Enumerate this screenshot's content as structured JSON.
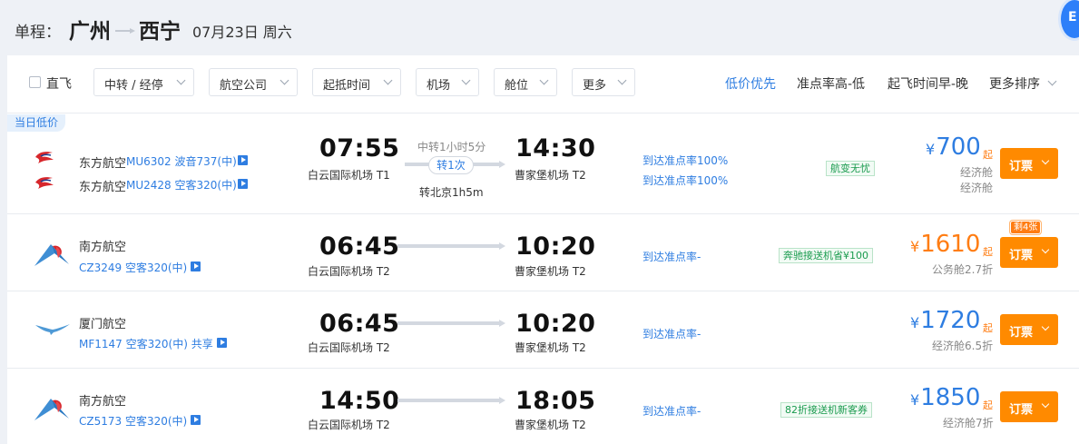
{
  "header": {
    "trip_label": "单程：",
    "from_city": "广州",
    "to_city": "西宁",
    "date": "07月23日 周六"
  },
  "filters": {
    "direct_label": "直飞",
    "dropdowns": [
      "中转 / 经停",
      "航空公司",
      "起抵时间",
      "机场",
      "舱位",
      "更多"
    ]
  },
  "sorts": [
    "低价优先",
    "准点率高-低",
    "起飞时间早-晚",
    "更多排序"
  ],
  "colors": {
    "accent": "#2e7de1",
    "book_button": "#ff8a00",
    "price_orange": "#ff7d13",
    "service_green": "#1a9b4e"
  },
  "flights": [
    {
      "tag": "当日低价",
      "legs": [
        {
          "airline": "东方航空",
          "flight_no": "MU6302",
          "aircraft": "波音737(中)",
          "logo": "china-eastern-logo-icon"
        },
        {
          "airline": "东方航空",
          "flight_no": "MU2428",
          "aircraft": "空客320(中)",
          "logo": "china-eastern-logo-icon"
        }
      ],
      "dep_time": "07:55",
      "dep_airport": "白云国际机场",
      "dep_terminal": "T1",
      "transfer_duration": "中转1小时5分",
      "transfer_count": "转1次",
      "transfer_detail": "转北京1h5m",
      "arr_time": "14:30",
      "arr_airport": "曹家堡机场",
      "arr_terminal": "T2",
      "ontime": [
        "到达准点率100%",
        "到达准点率100%"
      ],
      "service": "航变无忧",
      "price": "700",
      "currency": "¥",
      "price_suffix": "起",
      "cabin": [
        "经济舱",
        "经济舱"
      ],
      "book_label": "订票"
    },
    {
      "airline": "南方航空",
      "flight_no": "CZ3249",
      "aircraft": "空客320(中)",
      "logo": "china-southern-logo-icon",
      "dep_time": "06:45",
      "dep_airport": "白云国际机场",
      "dep_terminal": "T2",
      "arr_time": "10:20",
      "arr_airport": "曹家堡机场",
      "arr_terminal": "T2",
      "ontime": "到达准点率-",
      "service": "奔驰接送机省¥100",
      "price": "1610",
      "currency": "¥",
      "price_suffix": "起",
      "cabin": "公务舱2.7折",
      "seats_left": "剩4张",
      "book_label": "订票"
    },
    {
      "airline": "厦门航空",
      "flight_no": "MF1147",
      "aircraft": "空客320(中)",
      "shared": "共享",
      "logo": "xiamen-airlines-logo-icon",
      "dep_time": "06:45",
      "dep_airport": "白云国际机场",
      "dep_terminal": "T2",
      "arr_time": "10:20",
      "arr_airport": "曹家堡机场",
      "arr_terminal": "T2",
      "ontime": "到达准点率-",
      "price": "1720",
      "currency": "¥",
      "price_suffix": "起",
      "cabin": "经济舱6.5折",
      "book_label": "订票"
    },
    {
      "airline": "南方航空",
      "flight_no": "CZ5173",
      "aircraft": "空客320(中)",
      "logo": "china-southern-logo-icon",
      "dep_time": "14:50",
      "dep_airport": "白云国际机场",
      "dep_terminal": "T2",
      "arr_time": "18:05",
      "arr_airport": "曹家堡机场",
      "arr_terminal": "T2",
      "ontime": "到达准点率-",
      "service": "82折接送机新客券",
      "price": "1850",
      "currency": "¥",
      "price_suffix": "起",
      "cabin": "经济舱7折",
      "book_label": "订票"
    }
  ]
}
